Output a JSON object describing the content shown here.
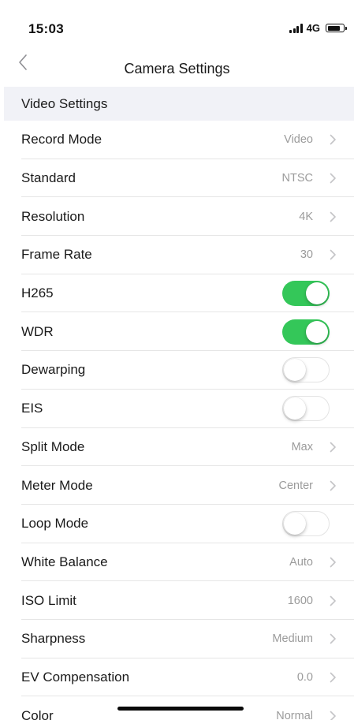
{
  "status_bar": {
    "time": "15:03",
    "network": "4G",
    "signal_icon": "cellular-signal-icon",
    "battery_icon": "battery-icon"
  },
  "nav": {
    "title": "Camera Settings",
    "back_icon": "chevron-left-icon"
  },
  "section": {
    "title": "Video Settings"
  },
  "colors": {
    "toggle_on": "#34c759",
    "section_bg": "#f1f2f7",
    "secondary_text": "#9b9b9b"
  },
  "rows": [
    {
      "label": "Record Mode",
      "type": "value",
      "value": "Video"
    },
    {
      "label": "Standard",
      "type": "value",
      "value": "NTSC"
    },
    {
      "label": "Resolution",
      "type": "value",
      "value": "4K"
    },
    {
      "label": "Frame Rate",
      "type": "value",
      "value": "30"
    },
    {
      "label": "H265",
      "type": "toggle",
      "on": true
    },
    {
      "label": "WDR",
      "type": "toggle",
      "on": true
    },
    {
      "label": "Dewarping",
      "type": "toggle",
      "on": false
    },
    {
      "label": "EIS",
      "type": "toggle",
      "on": false
    },
    {
      "label": "Split Mode",
      "type": "value",
      "value": "Max"
    },
    {
      "label": "Meter Mode",
      "type": "value",
      "value": "Center"
    },
    {
      "label": "Loop Mode",
      "type": "toggle",
      "on": false
    },
    {
      "label": "White Balance",
      "type": "value",
      "value": "Auto"
    },
    {
      "label": "ISO Limit",
      "type": "value",
      "value": "1600"
    },
    {
      "label": "Sharpness",
      "type": "value",
      "value": "Medium"
    },
    {
      "label": "EV Compensation",
      "type": "value",
      "value": "0.0"
    },
    {
      "label": "Color",
      "type": "value",
      "value": "Normal"
    }
  ]
}
